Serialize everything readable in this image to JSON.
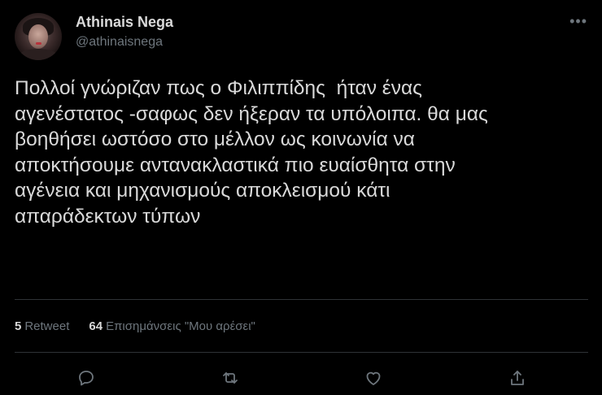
{
  "user": {
    "display_name": "Athinais Nega",
    "handle": "@athinaisnega"
  },
  "more_menu": {
    "glyph": "•••",
    "icon": "more-horizontal-icon"
  },
  "tweet": {
    "text": "Πολλοί γνώριζαν πως ο Φιλιππίδης  ήταν ένας\nαγενέστατος -σαφως δεν ήξεραν τα υπόλοιπα. θα μας\nβοηθήσει ωστόσο στο μέλλον ως κοινωνία να\nαποκτήσουμε αντανακλαστικά πιο ευαίσθητα στην\nαγένεια και μηχανισμούς αποκλεισμού κάτι\nαπαράδεκτων τύπων"
  },
  "stats": {
    "retweets_count": "5",
    "retweets_label": "Retweet",
    "likes_count": "64",
    "likes_label": "Επισημάνσεις \"Μου αρέσει\""
  },
  "actions": [
    {
      "name": "reply",
      "icon": "reply-icon"
    },
    {
      "name": "retweet",
      "icon": "retweet-icon"
    },
    {
      "name": "like",
      "icon": "heart-icon"
    },
    {
      "name": "share",
      "icon": "share-icon"
    }
  ],
  "colors": {
    "background": "#000000",
    "text": "#d9d9d9",
    "secondary": "#6e767d",
    "divider": "#2f3336"
  }
}
